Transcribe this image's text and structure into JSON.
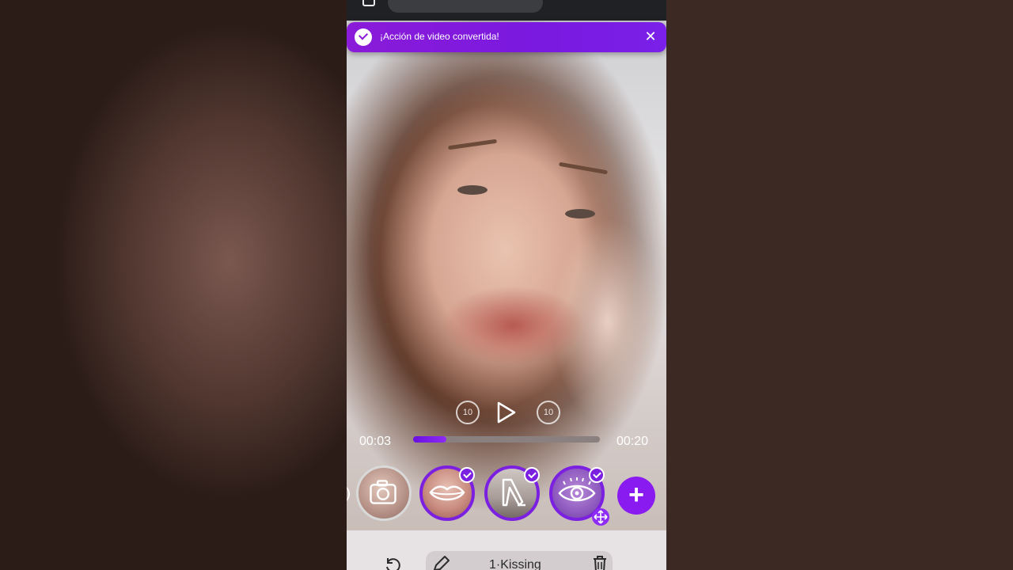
{
  "toast": {
    "message": "¡Acción de video convertida!",
    "close_glyph": "✕",
    "icon": "check-circle-icon",
    "color": "#8a1bd8"
  },
  "player": {
    "rewind_label": "10",
    "forward_label": "10",
    "current_time": "00:03",
    "duration": "00:20",
    "progress_fraction": 0.18
  },
  "effects": {
    "items": [
      {
        "name": "camera",
        "icon": "camera-icon",
        "selected": false
      },
      {
        "name": "lips",
        "icon": "lips-icon",
        "selected": true
      },
      {
        "name": "heels",
        "icon": "high-heel-icon",
        "selected": true
      },
      {
        "name": "eye",
        "icon": "eye-icon",
        "selected": true
      }
    ],
    "add_glyph": "+"
  },
  "toolbar": {
    "clip_label": "1·Kissing"
  },
  "colors": {
    "accent": "#7b20e0",
    "accent_bright": "#8e2bf5"
  }
}
